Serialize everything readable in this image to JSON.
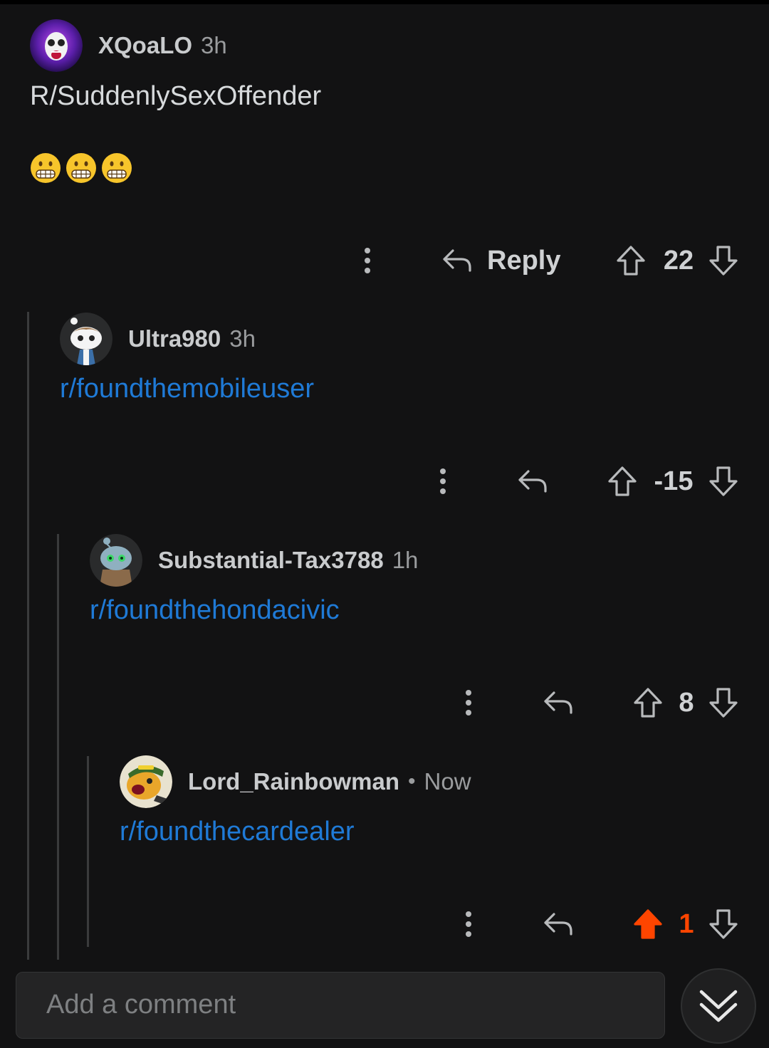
{
  "comments": [
    {
      "username": "XQoaLO",
      "time": "3h",
      "text": "R/SuddenlySexOffender",
      "emojis": [
        "grimacing-face",
        "grimacing-face",
        "grimacing-face"
      ],
      "reply_label": "Reply",
      "votes": "22",
      "upvoted": false
    },
    {
      "username": "Ultra980",
      "time": "3h",
      "text": "r/foundthemobileuser",
      "votes": "-15",
      "upvoted": false
    },
    {
      "username": "Substantial-Tax3788",
      "time": "1h",
      "text": "r/foundthehondacivic",
      "votes": "8",
      "upvoted": false
    },
    {
      "username": "Lord_Rainbowman",
      "separator": "•",
      "time": "Now",
      "text": "r/foundthecardealer",
      "votes": "1",
      "upvoted": true
    }
  ],
  "composer": {
    "placeholder": "Add a comment"
  },
  "colors": {
    "background": "#121213",
    "link": "#1f7ad6",
    "upvote": "#ff4500",
    "muted": "#9a9c9e"
  },
  "icons": [
    "kebab-menu-icon",
    "reply-arrow-icon",
    "upvote-arrow-icon",
    "downvote-arrow-icon",
    "chevron-down-double-icon"
  ]
}
